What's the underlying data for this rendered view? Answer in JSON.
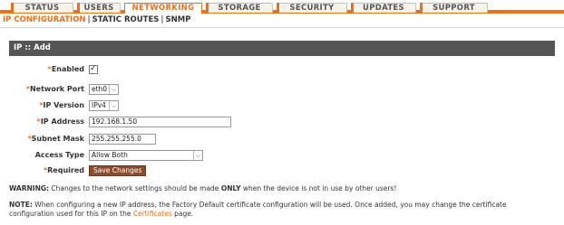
{
  "tabs": [
    {
      "label": "STATUS"
    },
    {
      "label": "USERS"
    },
    {
      "label": "NETWORKING"
    },
    {
      "label": "STORAGE"
    },
    {
      "label": "SECURITY"
    },
    {
      "label": "UPDATES"
    },
    {
      "label": "SUPPORT"
    }
  ],
  "active_tab": "NETWORKING",
  "subnav": [
    {
      "label": "IP CONFIGURATION"
    },
    {
      "label": "STATIC ROUTES"
    },
    {
      "label": "SNMP"
    }
  ],
  "panel": {
    "title": "IP :: Add"
  },
  "form": {
    "enabled_label": "Enabled",
    "enabled_checked": true,
    "network_port_label": "Network Port",
    "network_port_value": "eth0",
    "ip_version_label": "IP Version",
    "ip_version_value": "IPv4",
    "ip_address_label": "IP Address",
    "ip_address_value": "192.168.1.50",
    "subnet_mask_label": "Subnet Mask",
    "subnet_mask_value": "255.255.255.0",
    "access_type_label": "Access Type",
    "access_type_value": "Allow Both",
    "required_label": "Required",
    "save_label": "Save Changes"
  },
  "warning": {
    "prefix": "WARNING:",
    "text_before": "Changes to the network settings should be made",
    "emphasis": "ONLY",
    "text_after": "when the device is not in use by other users!"
  },
  "note": {
    "prefix": "NOTE:",
    "text": "When configuring a new IP address, the Factory Default certificate configuration will be used. Once added, you may change the certificate configuration used for this IP on the",
    "link": "Certificates",
    "suffix": "page."
  },
  "colors": {
    "accent": "#e8711a",
    "panel_header": "#555555",
    "button": "#8b4a2c"
  }
}
